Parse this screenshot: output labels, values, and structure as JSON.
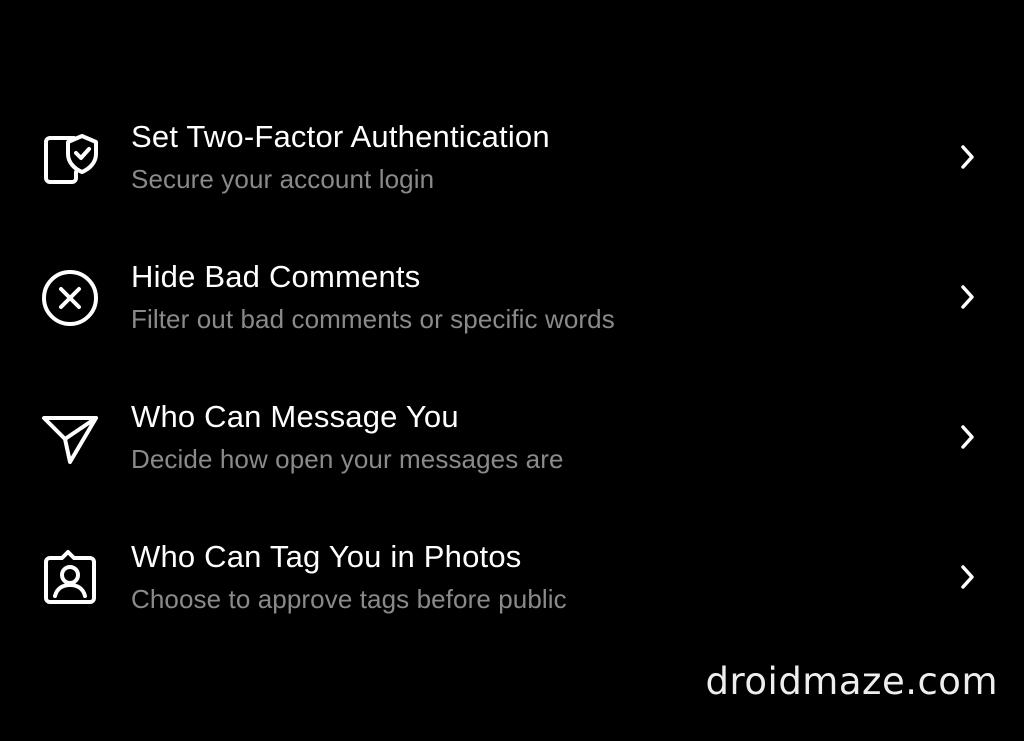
{
  "colors": {
    "background": "#000000",
    "title_text": "#ffffff",
    "subtitle_text": "#8a8a8a"
  },
  "settings_list": {
    "items": [
      {
        "icon": "phone-shield-icon",
        "title": "Set Two-Factor Authentication",
        "subtitle": "Secure your account login"
      },
      {
        "icon": "circle-x-icon",
        "title": "Hide Bad Comments",
        "subtitle": "Filter out bad comments or specific words"
      },
      {
        "icon": "send-paper-plane-icon",
        "title": "Who Can Message You",
        "subtitle": "Decide how open your messages are"
      },
      {
        "icon": "tag-person-icon",
        "title": "Who Can Tag You in Photos",
        "subtitle": "Choose to approve tags before public"
      }
    ]
  },
  "watermark": {
    "text": "droidmaze.com"
  }
}
